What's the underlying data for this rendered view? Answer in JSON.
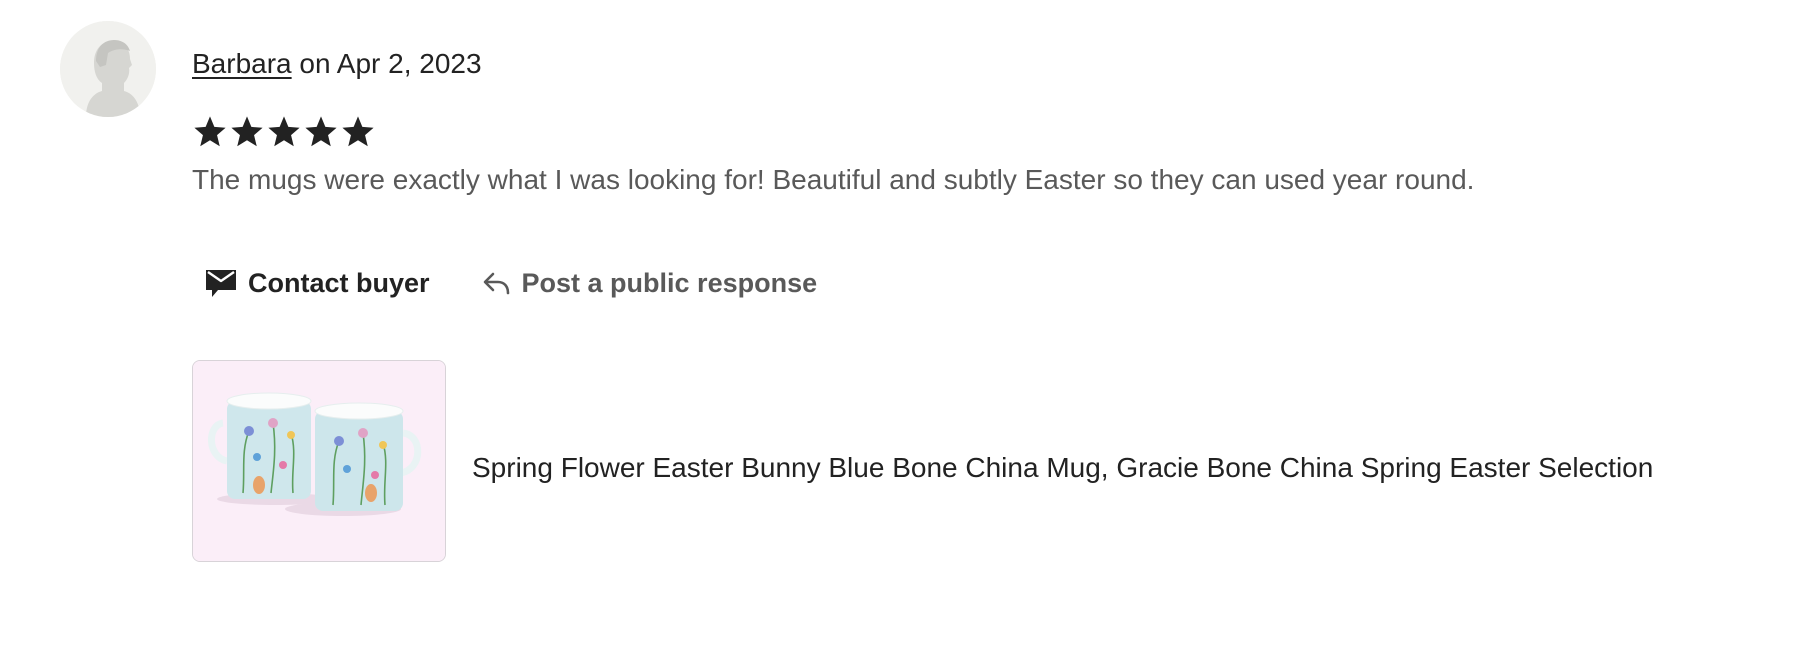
{
  "review": {
    "reviewer_name": "Barbara",
    "date_prefix": "on",
    "date": "Apr 2, 2023",
    "rating": 5,
    "rating_max": 5,
    "text": "The mugs were exactly what I was looking for! Beautiful and subtly Easter so they can used year round."
  },
  "actions": {
    "contact_label": "Contact buyer",
    "contact_icon": "envelope-icon",
    "respond_label": "Post a public response",
    "respond_icon": "reply-arrow-icon"
  },
  "listing": {
    "title": "Spring Flower Easter Bunny Blue Bone China Mug, Gracie Bone China Spring Easter Selection"
  },
  "colors": {
    "text": "#222222",
    "muted_text": "#595959",
    "star": "#222222",
    "avatar_bg": "#f1f1ee",
    "thumb_bg": "#fbeef8"
  }
}
